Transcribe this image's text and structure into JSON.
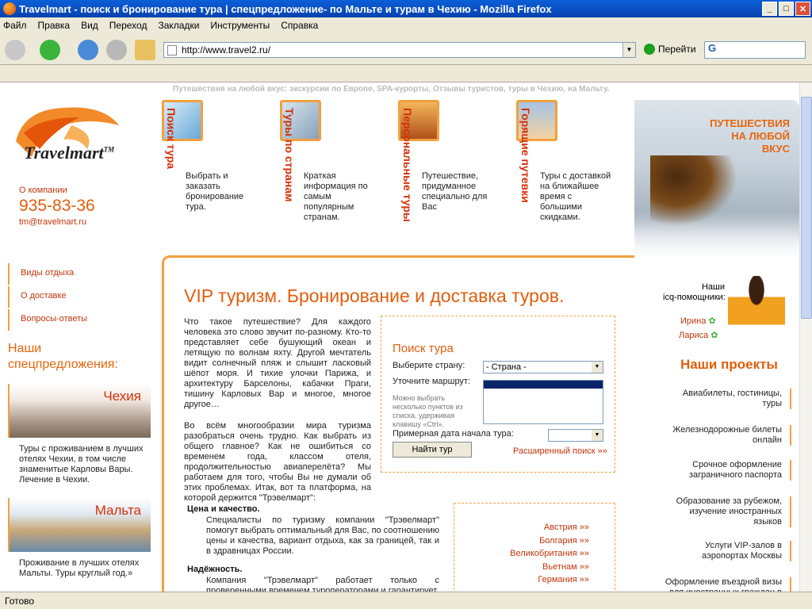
{
  "window": {
    "title": "Travelmart - поиск и бронирование тура | спецпредложение- по Мальте и турам в Чехию - Mozilla Firefox"
  },
  "menu": [
    "Файл",
    "Правка",
    "Вид",
    "Переход",
    "Закладки",
    "Инструменты",
    "Справка"
  ],
  "nav": {
    "url": "http://www.travel2.ru/",
    "go_label": "Перейти",
    "search_value": "G"
  },
  "status": "Готово",
  "site": {
    "tagline": "Путешествия на любой вкус: экскурсии по Европе, SPA-курорты, Отзывы туристов, туры в Чехию, на Мальту.",
    "logo_text": "Travelmart",
    "logo_tm": "TM",
    "company_label": "О компании",
    "phone": "935-83-36",
    "email": "tm@travelmart.ru"
  },
  "features": [
    {
      "title": "Поиск тура",
      "desc": "Выбрать и заказать бронирование тура."
    },
    {
      "title": "Туры по странам",
      "desc": "Краткая информация по самым популярным странам."
    },
    {
      "title": "Персональные туры",
      "desc": "Путешествие, придуманное специально для Вас"
    },
    {
      "title": "Горящие путевки",
      "desc": "Туры с доставкой на ближайшее время с большими скидками."
    }
  ],
  "hero": {
    "line1": "ПУТЕШЕСТВИЯ",
    "line2": "НА ЛЮБОЙ",
    "line3": "ВКУС"
  },
  "leftnav": [
    "Виды отдыха",
    "О доставке",
    "Вопросы-ответы"
  ],
  "specials": {
    "heading1": "Наши",
    "heading2": "спецпредложения:",
    "offers": [
      {
        "name": "Чехия",
        "text": "Туры с проживанием в лучших отелях Чехии, в том числе знаменитые Карловы Вары. Лечение в Чехии."
      },
      {
        "name": "Мальта",
        "text": "Проживание в лучших отелях Мальты. Туры круглый год.»"
      }
    ]
  },
  "main": {
    "heading": "VIP туризм. Бронирование и доставка туров.",
    "intro_p1": "Что такое путешествие? Для каждого человека это слово звучит по-разному. Кто-то представляет себе бушующий океан и летящую по волнам яхту. Другой мечтатель видит солнечный пляж и слышит ласковый шёпот моря. И тихие улочки Парижа, и архитектуру Барселоны, кабачки Праги, тишину Карловых Вар и многое, многое другое…",
    "intro_p2": "Во всём многообразии мира туризма разобраться очень трудно. Как выбрать из общего главное? Как не ошибиться со временем года, классом отеля, продолжительностью авиаперелёта? Мы работаем для того, чтобы Вы не думали об этих проблемах. Итак, вот та платформа, на которой держится \"Трэвелмарт\":",
    "sec1_title": "Цена и качество.",
    "sec1_text": "Специалисты по туризму компании \"Трэвелмарт\" помогут выбрать оптимальный для Вас, по соотношению цены и качества, вариант отдыха, как за границей, так и в здравницах России.",
    "sec2_title": "Надёжность.",
    "sec2_text": "Компания \"Трэвелмарт\" работает только с проверенными временем туроператорами и гарантирует"
  },
  "search": {
    "title": "Поиск тура",
    "country_label": "Выберите страну:",
    "country_value": "- Страна -",
    "route_label": "Уточните маршрут:",
    "hint": "Можно выбрать несколько пунктов из списка, удерживая клавишу «Ctrl».",
    "date_label": "Примерная дата начала тура:",
    "submit_label": "Найти тур",
    "advanced_label": "Расширенный поиск »»"
  },
  "countries": [
    "Австрия »»",
    "Болгария »»",
    "Великобритания »»",
    "Вьетнам »»",
    "Германия »»"
  ],
  "icq": {
    "label1": "Наши",
    "label2": "icq-помощники:",
    "agents": [
      "Ирина",
      "Лариса"
    ]
  },
  "projects": {
    "heading": "Наши проекты",
    "items": [
      "Авиабилеты, гостиницы, туры",
      "Железнодорожные билеты онлайн",
      "Срочное оформление заграничного паспорта",
      "Образование за рубежом, изучение иностранных языков",
      "Услуги VIP-залов в аэропортах Москвы",
      "Оформление въездной визы для иностранных граждан в"
    ]
  },
  "colors": {
    "accent": "#e35d0c",
    "link": "#c0350b",
    "frame": "#f2a040"
  }
}
